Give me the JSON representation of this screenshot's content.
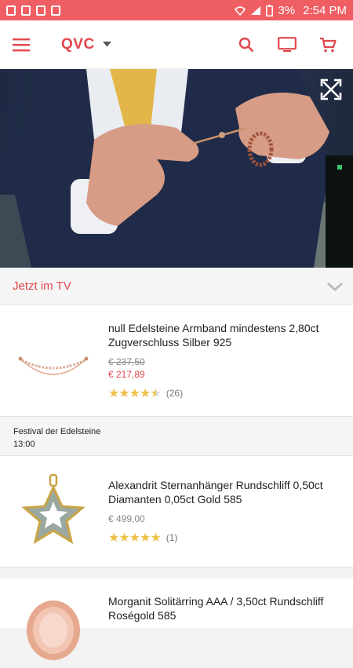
{
  "status_bar": {
    "battery": "3%",
    "time": "2:54 PM"
  },
  "app_bar": {
    "brand": "QVC",
    "icons": [
      "menu-icon",
      "dropdown-arrow-icon",
      "search-icon",
      "tv-icon",
      "cart-icon"
    ]
  },
  "video": {
    "fullscreen_icon": "expand-icon"
  },
  "now_on_tv": {
    "title": "Jetzt im TV",
    "icon": "chevron-down-icon"
  },
  "products": [
    {
      "title": "null Edelsteine Armband mindestens 2,80ct Zugverschluss Silber 925",
      "old_price": "€ 237,50",
      "price": "€ 217,89",
      "rating": 4.5,
      "stars": "★★★★★",
      "review_count": "(26)"
    },
    {
      "title": "Alexandrit Sternanhänger Rundschliff 0,50ct Diamanten 0,05ct Gold 585",
      "price": "€ 499,00",
      "rating": 5,
      "stars": "★★★★★",
      "review_count": "(1)"
    },
    {
      "title": "Morganit Solitärring AAA / 3,50ct Rundschliff Roségold 585"
    }
  ],
  "show": {
    "name": "Festival der Edelsteine",
    "time": "13:00"
  },
  "colors": {
    "brand_red": "#e2474c",
    "status_bar": "#ef5e63",
    "star": "#eec04a"
  }
}
